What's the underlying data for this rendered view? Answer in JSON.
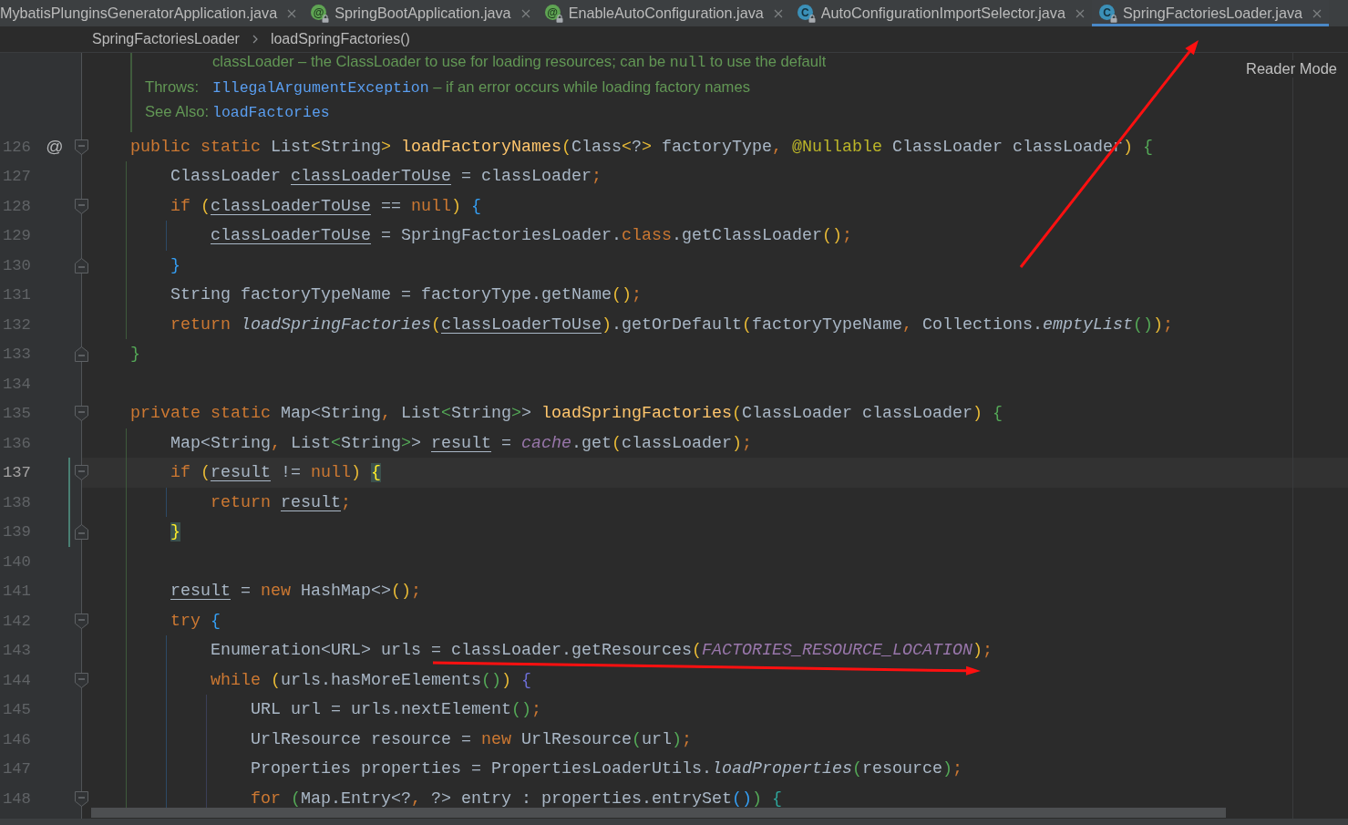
{
  "tabs": [
    {
      "title": "MybatisPlunginsGeneratorApplication.java",
      "selected": false
    },
    {
      "title": "SpringBootApplication.java",
      "selected": false,
      "icon": {
        "kind": "annotation",
        "glyph": "@",
        "locked": true
      }
    },
    {
      "title": "EnableAutoConfiguration.java",
      "selected": false,
      "icon": {
        "kind": "annotation",
        "glyph": "@",
        "locked": true
      }
    },
    {
      "title": "AutoConfigurationImportSelector.java",
      "selected": false,
      "icon": {
        "kind": "class",
        "glyph": "C",
        "locked": true
      }
    },
    {
      "title": "SpringFactoriesLoader.java",
      "selected": true,
      "icon": {
        "kind": "class",
        "glyph": "C",
        "locked": true
      }
    }
  ],
  "breadcrumbs": [
    "SpringFactoriesLoader",
    "loadSpringFactories()"
  ],
  "reader_mode": "Reader Mode",
  "doc": [
    {
      "parts": [
        {
          "kind": "text",
          "text": "classLoader – the ClassLoader to use for loading resources; can be "
        },
        {
          "kind": "code",
          "text": "null"
        },
        {
          "kind": "text",
          "text": " to use the default"
        }
      ]
    },
    {
      "label": "Throws:",
      "parts": [
        {
          "kind": "link",
          "text": "IllegalArgumentException"
        },
        {
          "kind": "text",
          "text": " – if an error occurs while loading factory names"
        }
      ]
    },
    {
      "label": "See Also:",
      "parts": [
        {
          "kind": "link",
          "text": "loadFactories"
        }
      ]
    }
  ],
  "code": [
    {
      "number": "126",
      "kind": "block_start",
      "marker": "@",
      "current": false,
      "changed": false,
      "tokens": [
        {
          "kind": "keyword",
          "text": "public static "
        },
        {
          "kind": "plain",
          "text": "List"
        },
        {
          "kind": "bracket_1",
          "text": "<"
        },
        {
          "kind": "plain",
          "text": "String"
        },
        {
          "kind": "bracket_1",
          "text": "> "
        },
        {
          "kind": "declaration",
          "text": "loadFactoryNames"
        },
        {
          "kind": "bracket_1",
          "text": "("
        },
        {
          "kind": "plain",
          "text": "Class"
        },
        {
          "kind": "bracket_1",
          "text": "<"
        },
        {
          "kind": "plain",
          "text": "?"
        },
        {
          "kind": "bracket_1",
          "text": ">"
        },
        {
          "kind": "plain",
          "text": " factoryType"
        },
        {
          "kind": "punctuation",
          "text": ", "
        },
        {
          "kind": "annotation",
          "text": "@Nullable"
        },
        {
          "kind": "plain",
          "text": " ClassLoader classLoader"
        },
        {
          "kind": "bracket_1",
          "text": ") "
        },
        {
          "kind": "bracket_2",
          "text": "{"
        }
      ],
      "children": [
        {
          "number": "127",
          "kind": "statement",
          "current": false,
          "changed": false,
          "tokens": [
            {
              "kind": "plain",
              "text": "ClassLoader "
            },
            {
              "kind": "reassigned",
              "text": "classLoaderToUse"
            },
            {
              "kind": "plain",
              "text": " = classLoader"
            },
            {
              "kind": "punctuation",
              "text": ";"
            }
          ]
        },
        {
          "number": "128",
          "kind": "block_start",
          "current": false,
          "changed": false,
          "tokens": [
            {
              "kind": "keyword",
              "text": "if "
            },
            {
              "kind": "bracket_1",
              "text": "("
            },
            {
              "kind": "reassigned",
              "text": "classLoaderToUse"
            },
            {
              "kind": "plain",
              "text": " == "
            },
            {
              "kind": "keyword",
              "text": "null"
            },
            {
              "kind": "bracket_1",
              "text": ") "
            },
            {
              "kind": "bracket_3",
              "text": "{"
            }
          ],
          "children": [
            {
              "number": "129",
              "kind": "statement",
              "current": false,
              "changed": false,
              "tokens": [
                {
                  "kind": "reassigned",
                  "text": "classLoaderToUse"
                },
                {
                  "kind": "plain",
                  "text": " = SpringFactoriesLoader."
                },
                {
                  "kind": "keyword",
                  "text": "class"
                },
                {
                  "kind": "plain",
                  "text": ".getClassLoader"
                },
                {
                  "kind": "bracket_1",
                  "text": "()"
                },
                {
                  "kind": "punctuation",
                  "text": ";"
                }
              ]
            }
          ]
        },
        {
          "number": "130",
          "kind": "block_end",
          "current": false,
          "changed": false,
          "tokens": [
            {
              "kind": "bracket_3",
              "text": "}"
            }
          ]
        },
        {
          "number": "131",
          "kind": "statement",
          "current": false,
          "changed": false,
          "tokens": [
            {
              "kind": "plain",
              "text": "String factoryTypeName = factoryType.getName"
            },
            {
              "kind": "bracket_1",
              "text": "()"
            },
            {
              "kind": "punctuation",
              "text": ";"
            }
          ]
        },
        {
          "number": "132",
          "kind": "statement",
          "current": false,
          "changed": false,
          "tokens": [
            {
              "kind": "keyword",
              "text": "return "
            },
            {
              "kind": "static_call",
              "text": "loadSpringFactories"
            },
            {
              "kind": "bracket_1",
              "text": "("
            },
            {
              "kind": "reassigned",
              "text": "classLoaderToUse"
            },
            {
              "kind": "bracket_1",
              "text": ")"
            },
            {
              "kind": "plain",
              "text": ".getOrDefault"
            },
            {
              "kind": "bracket_1",
              "text": "("
            },
            {
              "kind": "plain",
              "text": "factoryTypeName"
            },
            {
              "kind": "punctuation",
              "text": ", "
            },
            {
              "kind": "plain",
              "text": "Collections."
            },
            {
              "kind": "static_call",
              "text": "emptyList"
            },
            {
              "kind": "bracket_2",
              "text": "()"
            },
            {
              "kind": "bracket_1",
              "text": ")"
            },
            {
              "kind": "punctuation",
              "text": ";"
            }
          ]
        }
      ]
    },
    {
      "number": "133",
      "kind": "block_end",
      "current": false,
      "changed": false,
      "tokens": [
        {
          "kind": "bracket_2",
          "text": "}"
        }
      ]
    },
    {
      "number": "134",
      "kind": "blank",
      "current": false,
      "changed": false
    },
    {
      "number": "135",
      "kind": "block_start",
      "current": false,
      "changed": false,
      "tokens": [
        {
          "kind": "keyword",
          "text": "private static "
        },
        {
          "kind": "plain",
          "text": "Map<String"
        },
        {
          "kind": "punctuation",
          "text": ", "
        },
        {
          "kind": "plain",
          "text": "List"
        },
        {
          "kind": "bracket_2",
          "text": "<"
        },
        {
          "kind": "plain",
          "text": "String"
        },
        {
          "kind": "bracket_2",
          "text": ">"
        },
        {
          "kind": "plain",
          "text": "> "
        },
        {
          "kind": "declaration",
          "text": "loadSpringFactories"
        },
        {
          "kind": "bracket_1",
          "text": "("
        },
        {
          "kind": "plain",
          "text": "ClassLoader classLoader"
        },
        {
          "kind": "bracket_1",
          "text": ") "
        },
        {
          "kind": "bracket_2",
          "text": "{"
        }
      ],
      "children": [
        {
          "number": "136",
          "kind": "statement",
          "current": false,
          "changed": false,
          "tokens": [
            {
              "kind": "plain",
              "text": "Map<String"
            },
            {
              "kind": "punctuation",
              "text": ", "
            },
            {
              "kind": "plain",
              "text": "List"
            },
            {
              "kind": "bracket_2",
              "text": "<"
            },
            {
              "kind": "plain",
              "text": "String"
            },
            {
              "kind": "bracket_2",
              "text": ">"
            },
            {
              "kind": "plain",
              "text": "> "
            },
            {
              "kind": "reassigned",
              "text": "result"
            },
            {
              "kind": "plain",
              "text": " = "
            },
            {
              "kind": "static_field",
              "text": "cache"
            },
            {
              "kind": "plain",
              "text": ".get"
            },
            {
              "kind": "bracket_1",
              "text": "("
            },
            {
              "kind": "plain",
              "text": "classLoader"
            },
            {
              "kind": "bracket_1",
              "text": ")"
            },
            {
              "kind": "punctuation",
              "text": ";"
            }
          ]
        },
        {
          "number": "137",
          "kind": "block_start",
          "current": true,
          "changed": true,
          "tokens": [
            {
              "kind": "keyword",
              "text": "if "
            },
            {
              "kind": "bracket_1",
              "text": "("
            },
            {
              "kind": "reassigned",
              "text": "result"
            },
            {
              "kind": "plain",
              "text": " != "
            },
            {
              "kind": "keyword",
              "text": "null"
            },
            {
              "kind": "bracket_1",
              "text": ") "
            },
            {
              "kind": "brace_match",
              "text": "{"
            }
          ],
          "children": [
            {
              "number": "138",
              "kind": "statement",
              "current": false,
              "changed": true,
              "tokens": [
                {
                  "kind": "keyword",
                  "text": "return "
                },
                {
                  "kind": "reassigned",
                  "text": "result"
                },
                {
                  "kind": "punctuation",
                  "text": ";"
                }
              ]
            }
          ]
        },
        {
          "number": "139",
          "kind": "block_end",
          "current": false,
          "changed": true,
          "tokens": [
            {
              "kind": "brace_match",
              "text": "}"
            }
          ]
        },
        {
          "number": "140",
          "kind": "blank",
          "current": false,
          "changed": false
        },
        {
          "number": "141",
          "kind": "statement",
          "current": false,
          "changed": false,
          "tokens": [
            {
              "kind": "reassigned",
              "text": "result"
            },
            {
              "kind": "plain",
              "text": " = "
            },
            {
              "kind": "keyword",
              "text": "new "
            },
            {
              "kind": "plain",
              "text": "HashMap<>"
            },
            {
              "kind": "bracket_1",
              "text": "()"
            },
            {
              "kind": "punctuation",
              "text": ";"
            }
          ]
        },
        {
          "number": "142",
          "kind": "block_start",
          "current": false,
          "changed": false,
          "tokens": [
            {
              "kind": "keyword",
              "text": "try "
            },
            {
              "kind": "bracket_3",
              "text": "{"
            }
          ],
          "children": [
            {
              "number": "143",
              "kind": "statement",
              "current": false,
              "changed": false,
              "tokens": [
                {
                  "kind": "plain",
                  "text": "Enumeration<URL> urls = classLoader.getResources"
                },
                {
                  "kind": "bracket_1",
                  "text": "("
                },
                {
                  "kind": "static_field",
                  "text": "FACTORIES_RESOURCE_LOCATION"
                },
                {
                  "kind": "bracket_1",
                  "text": ")"
                },
                {
                  "kind": "punctuation",
                  "text": ";"
                }
              ]
            },
            {
              "number": "144",
              "kind": "block_start",
              "current": false,
              "changed": false,
              "tokens": [
                {
                  "kind": "keyword",
                  "text": "while "
                },
                {
                  "kind": "bracket_1",
                  "text": "("
                },
                {
                  "kind": "plain",
                  "text": "urls.hasMoreElements"
                },
                {
                  "kind": "bracket_2",
                  "text": "()"
                },
                {
                  "kind": "bracket_1",
                  "text": ") "
                },
                {
                  "kind": "bracket_4",
                  "text": "{"
                }
              ],
              "children": [
                {
                  "number": "145",
                  "kind": "statement",
                  "current": false,
                  "changed": false,
                  "tokens": [
                    {
                      "kind": "plain",
                      "text": "URL url = urls.nextElement"
                    },
                    {
                      "kind": "bracket_2",
                      "text": "()"
                    },
                    {
                      "kind": "punctuation",
                      "text": ";"
                    }
                  ]
                },
                {
                  "number": "146",
                  "kind": "statement",
                  "current": false,
                  "changed": false,
                  "tokens": [
                    {
                      "kind": "plain",
                      "text": "UrlResource resource = "
                    },
                    {
                      "kind": "keyword",
                      "text": "new "
                    },
                    {
                      "kind": "plain",
                      "text": "UrlResource"
                    },
                    {
                      "kind": "bracket_2",
                      "text": "("
                    },
                    {
                      "kind": "plain",
                      "text": "url"
                    },
                    {
                      "kind": "bracket_2",
                      "text": ")"
                    },
                    {
                      "kind": "punctuation",
                      "text": ";"
                    }
                  ]
                },
                {
                  "number": "147",
                  "kind": "statement",
                  "current": false,
                  "changed": false,
                  "tokens": [
                    {
                      "kind": "plain",
                      "text": "Properties properties = PropertiesLoaderUtils."
                    },
                    {
                      "kind": "static_call",
                      "text": "loadProperties"
                    },
                    {
                      "kind": "bracket_2",
                      "text": "("
                    },
                    {
                      "kind": "plain",
                      "text": "resource"
                    },
                    {
                      "kind": "bracket_2",
                      "text": ")"
                    },
                    {
                      "kind": "punctuation",
                      "text": ";"
                    }
                  ]
                },
                {
                  "number": "148",
                  "kind": "block_start",
                  "current": false,
                  "changed": false,
                  "tokens": [
                    {
                      "kind": "keyword",
                      "text": "for "
                    },
                    {
                      "kind": "bracket_2",
                      "text": "("
                    },
                    {
                      "kind": "plain",
                      "text": "Map.Entry<?"
                    },
                    {
                      "kind": "punctuation",
                      "text": ", "
                    },
                    {
                      "kind": "plain",
                      "text": "?> entry : properties.entrySet"
                    },
                    {
                      "kind": "bracket_3",
                      "text": "()"
                    },
                    {
                      "kind": "bracket_2",
                      "text": ") "
                    },
                    {
                      "kind": "bracket_5",
                      "text": "{"
                    }
                  ]
                }
              ]
            }
          ]
        }
      ]
    }
  ]
}
